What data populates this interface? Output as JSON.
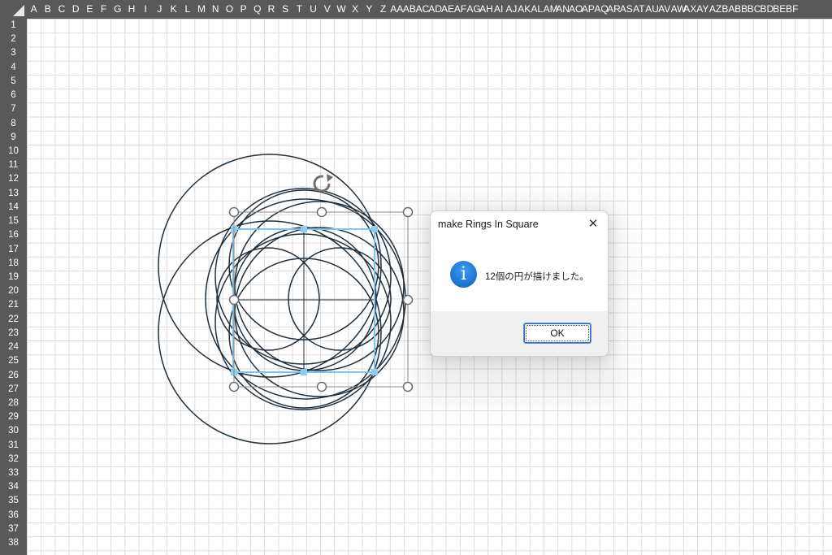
{
  "spreadsheet": {
    "columns": [
      "A",
      "B",
      "C",
      "D",
      "E",
      "F",
      "G",
      "H",
      "I",
      "J",
      "K",
      "L",
      "M",
      "N",
      "O",
      "P",
      "Q",
      "R",
      "S",
      "T",
      "U",
      "V",
      "W",
      "X",
      "Y",
      "Z",
      "AA",
      "AB",
      "AC",
      "AD",
      "AE",
      "AF",
      "AG",
      "AH",
      "AI",
      "AJ",
      "AK",
      "AL",
      "AM",
      "AN",
      "AO",
      "AP",
      "AQ",
      "AR",
      "AS",
      "AT",
      "AU",
      "AV",
      "AW",
      "AX",
      "AY",
      "AZ",
      "BA",
      "BB",
      "BC",
      "BD",
      "BE",
      "BF"
    ],
    "rows": [
      "1",
      "2",
      "3",
      "4",
      "5",
      "6",
      "7",
      "8",
      "9",
      "10",
      "11",
      "12",
      "13",
      "14",
      "15",
      "16",
      "17",
      "18",
      "19",
      "20",
      "21",
      "22",
      "23",
      "24",
      "25",
      "26",
      "27",
      "28",
      "29",
      "30",
      "31",
      "32",
      "33",
      "34",
      "35",
      "36",
      "37",
      "38"
    ],
    "colors": {
      "header_bg": "#595959",
      "header_text": "#ffffff",
      "gridline": "#dcdcdc",
      "ring_stroke": "#1f3140",
      "selection_outline": "#7ec3ec",
      "handle_fill": "#ffffff"
    }
  },
  "canvas": {
    "shape": "12 rings inside a selected square (group selected with resize handles)",
    "rotate_handle_icon": "rotate-icon"
  },
  "dialog": {
    "title": "make Rings In Square",
    "close_icon": "close-icon",
    "info_icon": "info-icon",
    "info_glyph": "i",
    "message": "12個の円が描けました。",
    "ok_label": "OK"
  }
}
